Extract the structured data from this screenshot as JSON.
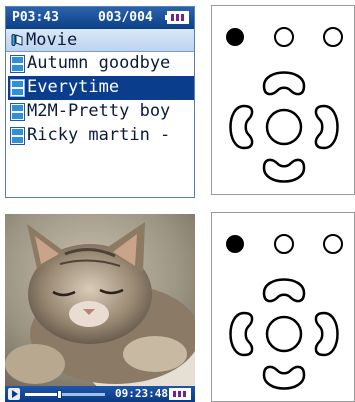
{
  "player_list": {
    "status": {
      "time": "P03:43",
      "track_count": "003/004",
      "battery_icon": "battery-icon"
    },
    "folder": {
      "label": "Movie",
      "icon": "folder-icon"
    },
    "items": [
      {
        "label": "Autumn goodbye",
        "selected": false
      },
      {
        "label": "Everytime",
        "selected": true
      },
      {
        "label": "M2M-Pretty boy",
        "selected": false
      },
      {
        "label": "Ricky martin -",
        "selected": false
      }
    ]
  },
  "video_player": {
    "time": "09:23:48",
    "progress": 0.42,
    "play_icon": "play-icon",
    "battery_icon": "battery-icon"
  },
  "colors": {
    "accent_blue": "#0a3d8c",
    "battery_fill": "#7a1f8c"
  }
}
